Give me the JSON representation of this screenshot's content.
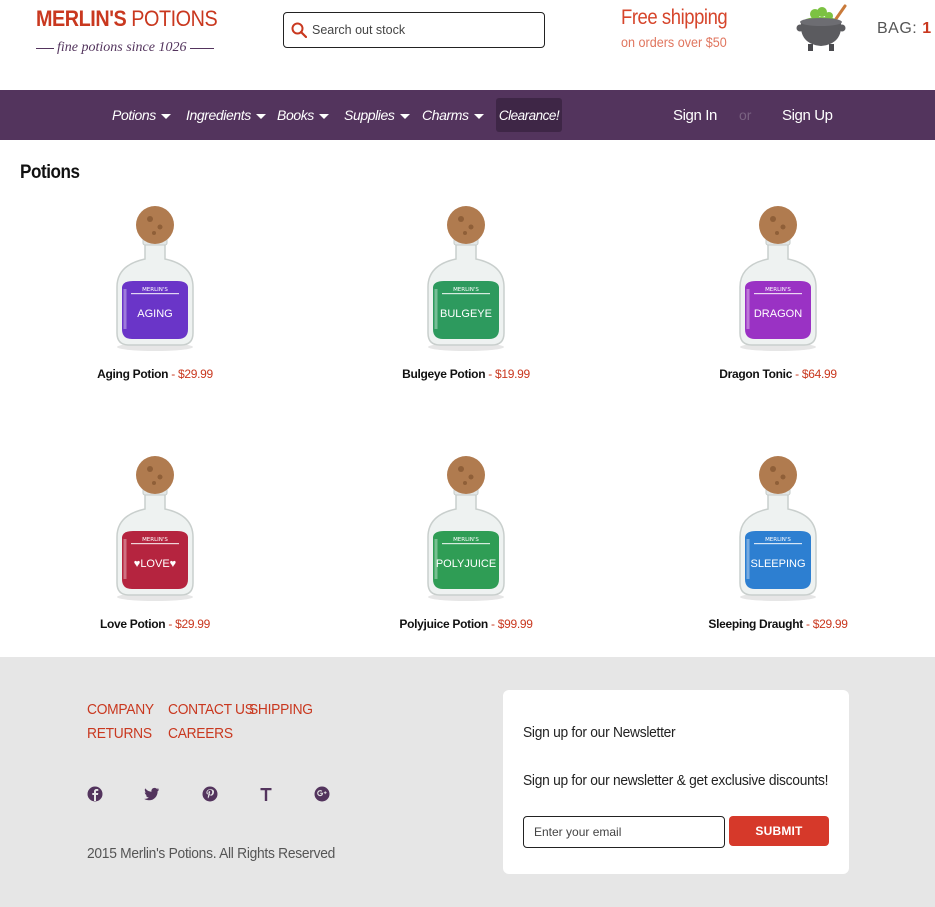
{
  "brand": {
    "name_bold": "MERLIN'S",
    "name_regular": "POTIONS",
    "tagline": "fine potions since 1026"
  },
  "search": {
    "placeholder": "Search out stock"
  },
  "shipping": {
    "title": "Free shipping",
    "subtitle": "on orders over $50"
  },
  "bag": {
    "label": "BAG:",
    "count": "1"
  },
  "nav": {
    "items": [
      {
        "label": "Potions"
      },
      {
        "label": "Ingredients"
      },
      {
        "label": "Books"
      },
      {
        "label": "Supplies"
      },
      {
        "label": "Charms"
      }
    ],
    "clearance": "Clearance!",
    "sign_in": "Sign In",
    "or": "or",
    "sign_up": "Sign Up"
  },
  "main": {
    "title": "Potions",
    "separator": " - ",
    "products": [
      {
        "name": "Aging Potion",
        "price": "$29.99",
        "label": "AGING",
        "color": "#6a35c8"
      },
      {
        "name": "Bulgeye Potion",
        "price": "$19.99",
        "label": "BULGEYE",
        "color": "#2d9a5e"
      },
      {
        "name": "Dragon Tonic",
        "price": "$64.99",
        "label": "DRAGON",
        "color": "#9a32c4"
      },
      {
        "name": "Love Potion",
        "price": "$29.99",
        "label": "♥LOVE♥",
        "color": "#b5243f"
      },
      {
        "name": "Polyjuice Potion",
        "price": "$99.99",
        "label": "POLYJUICE",
        "color": "#2f9d55"
      },
      {
        "name": "Sleeping Draught",
        "price": "$29.99",
        "label": "SLEEPING",
        "color": "#2d7fd1"
      }
    ]
  },
  "footer": {
    "links": {
      "company": "COMPANY",
      "contact": "CONTACT US",
      "shipping": "SHIPPING",
      "returns": "RETURNS",
      "careers": "CAREERS"
    },
    "social": [
      "facebook-icon",
      "twitter-icon",
      "pinterest-icon",
      "tumblr-icon",
      "google-plus-icon"
    ],
    "copyright": "2015 Merlin's Potions. All Rights Reserved",
    "newsletter": {
      "title": "Sign up for our Newsletter",
      "text": "Sign up for our newsletter & get exclusive discounts!",
      "placeholder": "Enter your email",
      "submit": "SUBMIT"
    }
  },
  "colors": {
    "brand_red": "#c9381f",
    "nav_purple": "#53345d",
    "footer_bg": "#e6e6e6",
    "submit_red": "#d6392a"
  }
}
